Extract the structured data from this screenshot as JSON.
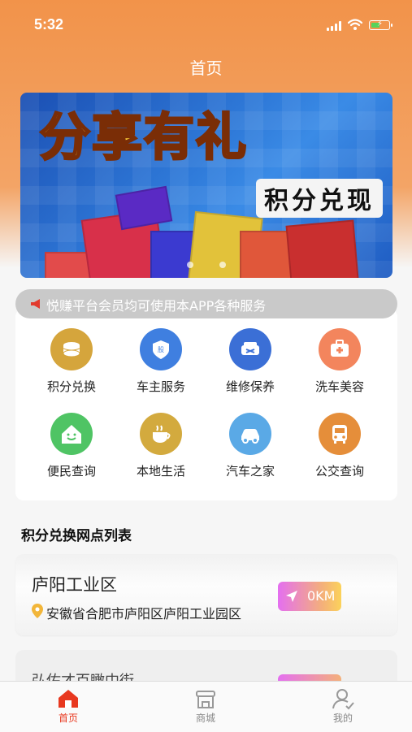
{
  "status_bar": {
    "time": "5:32"
  },
  "nav": {
    "title": "首页"
  },
  "banner": {
    "headline": "分享有礼",
    "subline": "积分兑现"
  },
  "notice": {
    "text": "悦赚平台会员均可使用本APP各种服务"
  },
  "services": [
    {
      "label": "积分兑换",
      "icon": "coins-icon",
      "color": "#d5a53c"
    },
    {
      "label": "车主服务",
      "icon": "badge-icon",
      "color": "#3f7fe0"
    },
    {
      "label": "维修保养",
      "icon": "repair-car-icon",
      "color": "#3b6fd6"
    },
    {
      "label": "洗车美容",
      "icon": "first-aid-icon",
      "color": "#f3855d"
    },
    {
      "label": "便民查询",
      "icon": "smiley-house-icon",
      "color": "#4fc464"
    },
    {
      "label": "本地生活",
      "icon": "coffee-cup-icon",
      "color": "#d3aa3e"
    },
    {
      "label": "汽车之家",
      "icon": "car-icon",
      "color": "#5aa9e6"
    },
    {
      "label": "公交查询",
      "icon": "bus-icon",
      "color": "#e58e3a"
    }
  ],
  "section": {
    "title": "积分兑换网点列表"
  },
  "outlets": [
    {
      "name": "庐阳工业区",
      "address": "安徽省合肥市庐阳区庐阳工业园区",
      "distance": "0KM"
    },
    {
      "name": "弘佑才百瞰中街",
      "address": ""
    }
  ],
  "tabbar": [
    {
      "label": "首页",
      "icon": "home-icon",
      "active": true
    },
    {
      "label": "商城",
      "icon": "store-icon",
      "active": false
    },
    {
      "label": "我的",
      "icon": "user-icon",
      "active": false
    }
  ],
  "colors": {
    "header": "#f2934a",
    "active_tab": "#e8381f"
  }
}
